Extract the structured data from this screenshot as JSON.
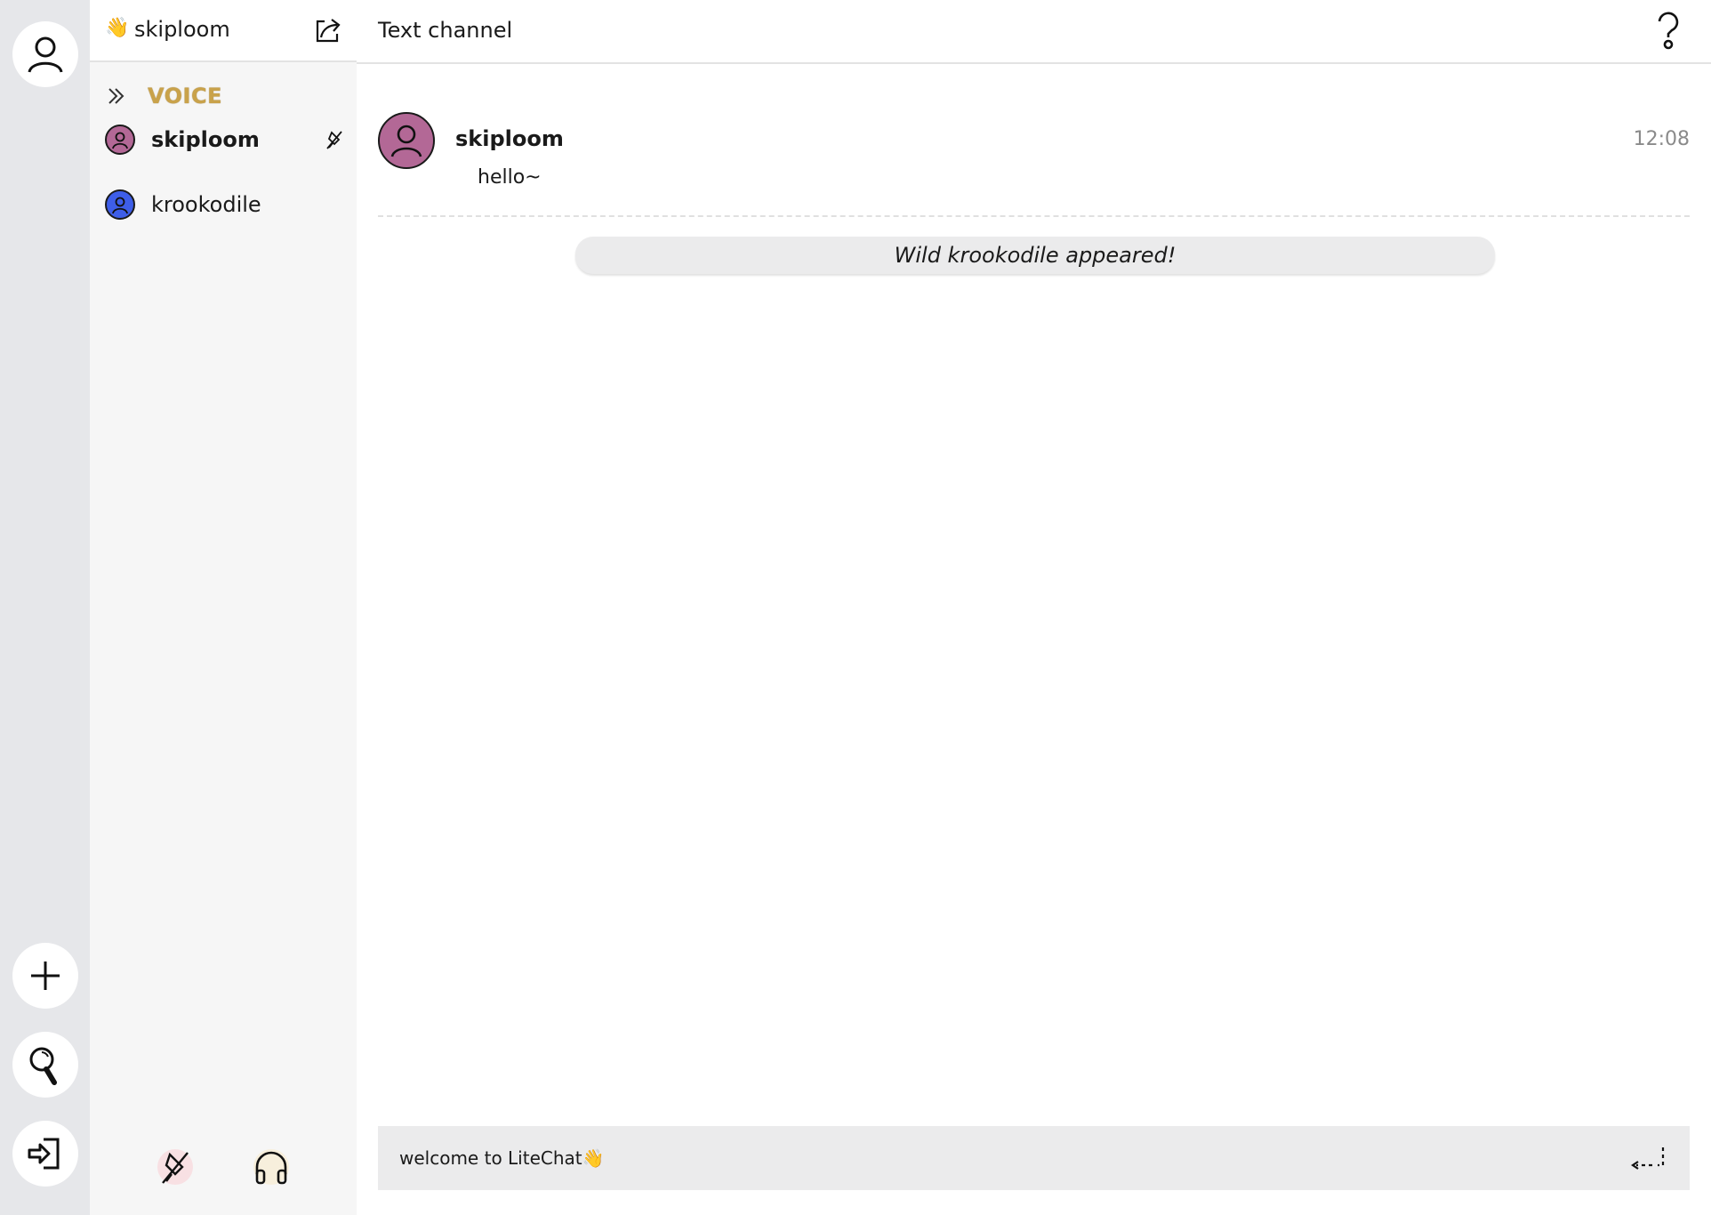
{
  "rail": {
    "items": [
      {
        "name": "profile",
        "icon": "user-icon"
      },
      {
        "name": "add-server",
        "icon": "plus-icon"
      },
      {
        "name": "search",
        "icon": "search-icon"
      },
      {
        "name": "login",
        "icon": "login-icon"
      }
    ]
  },
  "sidebar": {
    "header": {
      "emoji": "👋",
      "username": "skiploom",
      "share_icon": "share-external-icon"
    },
    "voice": {
      "label": "VOICE",
      "members": [
        {
          "name": "skiploom",
          "avatar_color": "#b36896",
          "muted": true
        },
        {
          "name": "krookodile",
          "avatar_color": "#3e5ee8",
          "muted": false
        }
      ]
    },
    "controls": {
      "mic_icon": "mic-muted-icon",
      "headphones_icon": "headphones-icon"
    }
  },
  "main": {
    "channel_title": "Text channel",
    "help_icon": "help-icon",
    "messages": [
      {
        "author": "skiploom",
        "time": "12:08",
        "text": "hello~",
        "avatar_color": "#b36896"
      }
    ],
    "system_notice": "Wild krookodile appeared!",
    "composer": {
      "placeholder": "welcome to LiteChat👋",
      "value": ""
    }
  },
  "colors": {
    "rail_bg": "#e6e7ea",
    "sidebar_bg": "#f6f6f6",
    "voice_label": "#c9a24a",
    "composer_bg": "#ebebec"
  }
}
